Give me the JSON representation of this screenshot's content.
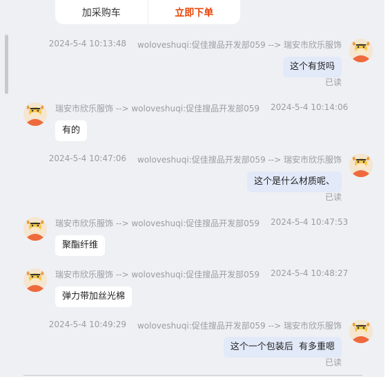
{
  "actions": {
    "add_cart": "加采购车",
    "buy_now": "立即下单"
  },
  "read_label": "已读",
  "messages": [
    {
      "direction": "out",
      "time": "2024-5-4 10:13:48",
      "route": "woloveshuqi:促佳搜品开发部059 --> 瑞安市欣乐服饰",
      "text": "这个有货吗",
      "read": true
    },
    {
      "direction": "in",
      "time": "2024-5-4 10:14:06",
      "route": "瑞安市欣乐服饰 --> woloveshuqi:促佳搜品开发部059",
      "text": "有的"
    },
    {
      "direction": "out",
      "time": "2024-5-4 10:47:06",
      "route": "woloveshuqi:促佳搜品开发部059 --> 瑞安市欣乐服饰",
      "text": "这个是什么材质呢、",
      "read": true
    },
    {
      "direction": "in",
      "time": "2024-5-4 10:47:53",
      "route": "瑞安市欣乐服饰 --> woloveshuqi:促佳搜品开发部059",
      "text": "聚酯纤维"
    },
    {
      "direction": "in",
      "time": "2024-5-4 10:48:27",
      "route": "瑞安市欣乐服饰 --> woloveshuqi:促佳搜品开发部059",
      "text": "弹力带加丝光棉"
    },
    {
      "direction": "out",
      "time": "2024-5-4 10:49:29",
      "route": "woloveshuqi:促佳搜品开发部059 --> 瑞安市欣乐服饰",
      "text": "这个一个包装后  有多重嗯",
      "read": true
    }
  ],
  "colors": {
    "accent_buy": "#e8460a",
    "bubble_out": "#e2e9f8",
    "bubble_in": "#ffffff",
    "background": "#eff0f4"
  },
  "icons": {
    "avatar": "cow-avatar-icon"
  }
}
